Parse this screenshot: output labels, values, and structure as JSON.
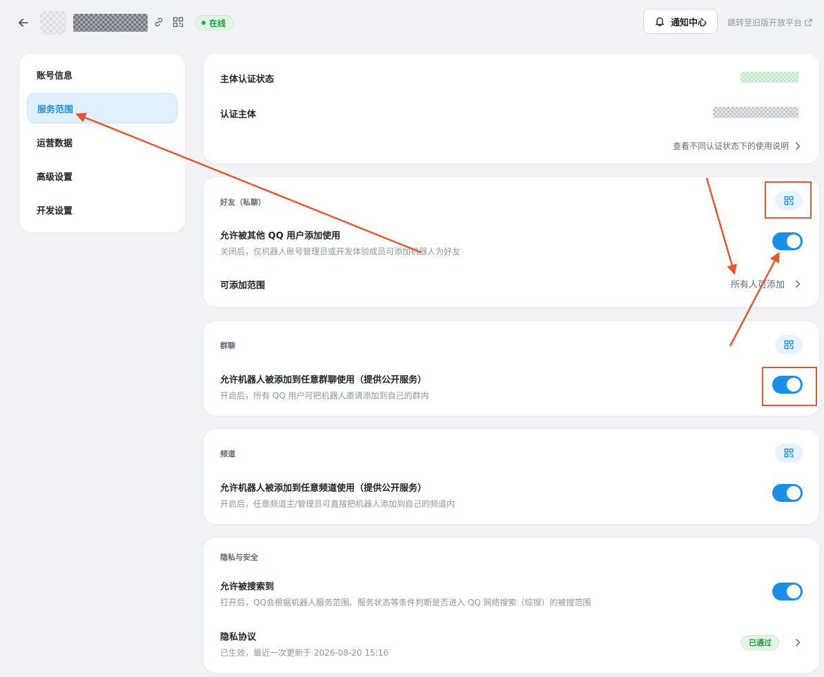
{
  "header": {
    "status": "在线",
    "notice_center": "通知中心",
    "old_platform": "跳转至旧版开放平台"
  },
  "sidebar": {
    "items": [
      {
        "label": "账号信息"
      },
      {
        "label": "服务范围",
        "active": true
      },
      {
        "label": "运营数据"
      },
      {
        "label": "高级设置"
      },
      {
        "label": "开发设置"
      }
    ]
  },
  "auth": {
    "status_label": "主体认证状态",
    "subject_label": "认证主体",
    "help_link": "查看不同认证状态下的使用说明"
  },
  "friends": {
    "title": "好友（私聊）",
    "allow_title": "允许被其他 QQ 用户添加使用",
    "allow_desc": "关闭后，仅机器人账号管理员或开发体验成员可添加机器人为好友",
    "allow_on": true,
    "scope_label": "可添加范围",
    "scope_value": "所有人可添加"
  },
  "groups": {
    "title": "群聊",
    "allow_title": "允许机器人被添加到任意群聊使用（提供公开服务）",
    "allow_desc": "开启后，所有 QQ 用户可把机器人邀请添加到自己的群内",
    "allow_on": true
  },
  "channels": {
    "title": "频道",
    "allow_title": "允许机器人被添加到任意频道使用（提供公开服务）",
    "allow_desc": "开启后，任意频道主/管理员可直接把机器人添加到自己的频道内",
    "allow_on": true
  },
  "privacy": {
    "title": "隐私与安全",
    "search_title": "允许被搜索到",
    "search_desc": "打开后，QQ会根据机器人服务范围、服务状态等条件判断是否进入 QQ 网络搜索（综搜）的被搜范围",
    "search_on": true,
    "policy_title": "隐私协议",
    "policy_desc": "已生效，最近一次更新于 2026-08-20 15:16",
    "policy_badge": "已通过"
  },
  "colors": {
    "accent": "#1b8fe6",
    "annotation": "#e4572e",
    "success": "#1f9d3a"
  }
}
